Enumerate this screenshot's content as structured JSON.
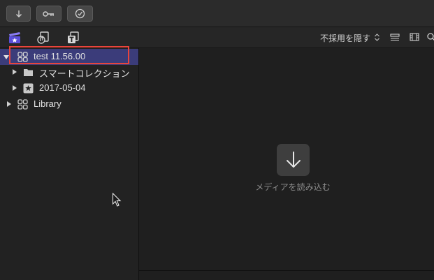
{
  "toolbar": {
    "buttons": [
      {
        "icon": "download-arrow-icon"
      },
      {
        "icon": "key-icon"
      },
      {
        "icon": "checkmark-circle-icon"
      }
    ]
  },
  "subbar": {
    "icons": [
      "libraries-clapper-icon",
      "photos-audio-icon",
      "titles-generators-icon"
    ],
    "filter_label": "不採用を隠す",
    "view_icons": [
      "list-view-icon",
      "filmstrip-view-icon",
      "search-icon"
    ]
  },
  "sidebar": {
    "items": [
      {
        "label": "test 11.56.00",
        "icon": "event-grid-icon",
        "selected": true,
        "expanded": true
      },
      {
        "label": "スマートコレクション",
        "icon": "folder-icon",
        "selected": false
      },
      {
        "label": "2017-05-04",
        "icon": "star-event-icon",
        "selected": false
      },
      {
        "label": "Library",
        "icon": "library-grid-icon",
        "selected": false
      }
    ]
  },
  "browser": {
    "import_label": "メディアを読み込む",
    "import_icon": "import-arrow-icon"
  },
  "colors": {
    "selection": "#3b3c7a",
    "highlight": "#e8453c",
    "accent_purple": "#7a6cf0"
  }
}
